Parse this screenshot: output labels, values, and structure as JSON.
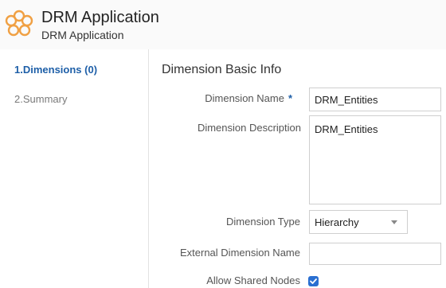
{
  "app": {
    "title": "DRM Application",
    "subtitle": "DRM Application",
    "logo_icon": "flower-logo-icon",
    "accent_color": "#f0a043"
  },
  "sidebar": {
    "items": [
      {
        "label": "1.Dimensions (0)",
        "active": true
      },
      {
        "label": "2.Summary",
        "active": false
      }
    ],
    "active_color": "#1e5fa8"
  },
  "form": {
    "section_title": "Dimension Basic Info",
    "dimension_name": {
      "label": "Dimension Name",
      "required_mark": "*",
      "value": "DRM_Entities"
    },
    "dimension_description": {
      "label": "Dimension Description",
      "value": "DRM_Entities"
    },
    "dimension_type": {
      "label": "Dimension Type",
      "value": "Hierarchy"
    },
    "external_dimension_name": {
      "label": "External Dimension Name",
      "value": ""
    },
    "allow_shared_nodes": {
      "label": "Allow Shared Nodes",
      "checked": true
    }
  }
}
